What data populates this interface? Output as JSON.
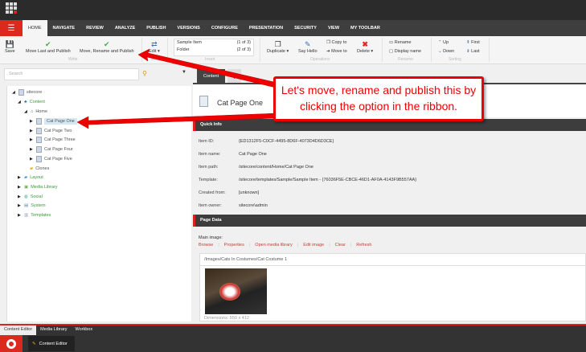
{
  "ribbon_tabs": [
    "HOME",
    "NAVIGATE",
    "REVIEW",
    "ANALYZE",
    "PUBLISH",
    "VERSIONS",
    "CONFIGURE",
    "PRESENTATION",
    "SECURITY",
    "VIEW",
    "MY TOOLBAR"
  ],
  "ribbon": {
    "save": "Save",
    "move_last": "Move Last and Publish",
    "move_rename": "Move, Rename and Publish",
    "edit": "Edit ▾",
    "write_group": "Write",
    "edit_group": "Edit",
    "insert_1": "Sample Item",
    "insert_1_count": "(1 of 3)",
    "insert_2": "Folder",
    "insert_2_count": "(2 of 3)",
    "insert_group": "Insert",
    "duplicate": "Duplicate ▾",
    "say_hello": "Say Hello",
    "copy_to": "Copy to",
    "move_to": "Move to",
    "delete": "Delete ▾",
    "operations_group": "Operations",
    "rename": "Rename",
    "display_name": "Display name",
    "rename_group": "Rename",
    "up": "Up",
    "down": "Down",
    "first": "First",
    "last": "Last",
    "sorting_group": "Sorting"
  },
  "search": {
    "placeholder": "Search"
  },
  "tree": [
    {
      "label": "sitecore"
    },
    {
      "label": "Content"
    },
    {
      "label": "Home"
    },
    {
      "label": "Cat Page One"
    },
    {
      "label": "Cat Page Two"
    },
    {
      "label": "Cat Page Three"
    },
    {
      "label": "Cat Page Four"
    },
    {
      "label": "Cat Page Five"
    },
    {
      "label": "Clones"
    },
    {
      "label": "Layout"
    },
    {
      "label": "Media Library"
    },
    {
      "label": "Social"
    },
    {
      "label": "System"
    },
    {
      "label": "Templates"
    }
  ],
  "editor": {
    "content_tab": "Content",
    "title": "Cat Page One",
    "quick_info": "Quick Info",
    "fields": [
      {
        "k": "Item ID:",
        "v": "{ED1312F5-C0CF-4495-8D6F-4073D4D6D3CE}"
      },
      {
        "k": "Item name:",
        "v": "Cat Page One"
      },
      {
        "k": "Item path:",
        "v": "/sitecore/content/Home/Cat Page One"
      },
      {
        "k": "Template:",
        "v": "/sitecore/templates/Sample/Sample Item - {76036F5E-CBCE-46D1-AF0A-4143F9B557AA}"
      },
      {
        "k": "Created from:",
        "v": "[unknown]"
      },
      {
        "k": "Item owner:",
        "v": "sitecore\\admin"
      }
    ],
    "page_data": "Page Data",
    "main_image": "Main image:",
    "links": [
      "Browse",
      "Properties",
      "Open media library",
      "Edit image",
      "Clear",
      "Refresh"
    ],
    "image_path": "/Images/Cats In Costumes/Cat Costume 1",
    "dimensions": "Dimensions: 550 x 412"
  },
  "bottom_tabs": [
    "Content Editor",
    "Media Library",
    "Workbox"
  ],
  "taskbar": {
    "app": "Content Editor"
  },
  "callout": "Let's move, rename and publish this by clicking the option in the ribbon.",
  "colors": {
    "accent": "#dc291e",
    "callout": "#e00000"
  }
}
